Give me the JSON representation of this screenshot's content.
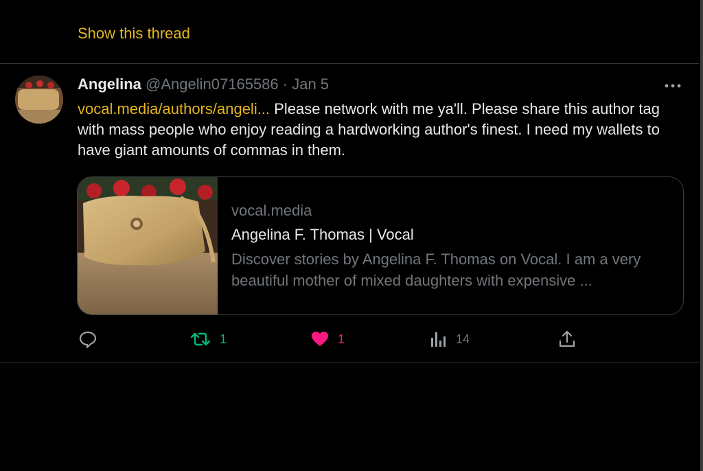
{
  "thread": {
    "show_label": "Show this thread"
  },
  "tweet": {
    "author_name": "Angelina",
    "handle": "@Angelin07165586",
    "separator": "·",
    "date": "Jan 5",
    "link_text": "vocal.media/authors/angeli...",
    "text": " Please network with me ya'll. Please share this author tag with mass people who enjoy reading a hardworking author's finest. I need my wallets to have giant amounts of commas in them.",
    "card": {
      "domain": "vocal.media",
      "title": "Angelina F. Thomas | Vocal",
      "description": "Discover stories by Angelina F. Thomas on Vocal. I am a very beautiful mother of mixed daughters with expensive ..."
    },
    "actions": {
      "retweets": "1",
      "likes": "1",
      "views": "14"
    }
  },
  "colors": {
    "background": "#000000",
    "accent_link": "#e4b51d",
    "retweet": "#00ba7c",
    "like": "#f91880",
    "muted": "#71767b"
  },
  "icons": [
    "more-icon",
    "reply-icon",
    "retweet-icon",
    "heart-icon",
    "views-icon",
    "share-icon"
  ]
}
